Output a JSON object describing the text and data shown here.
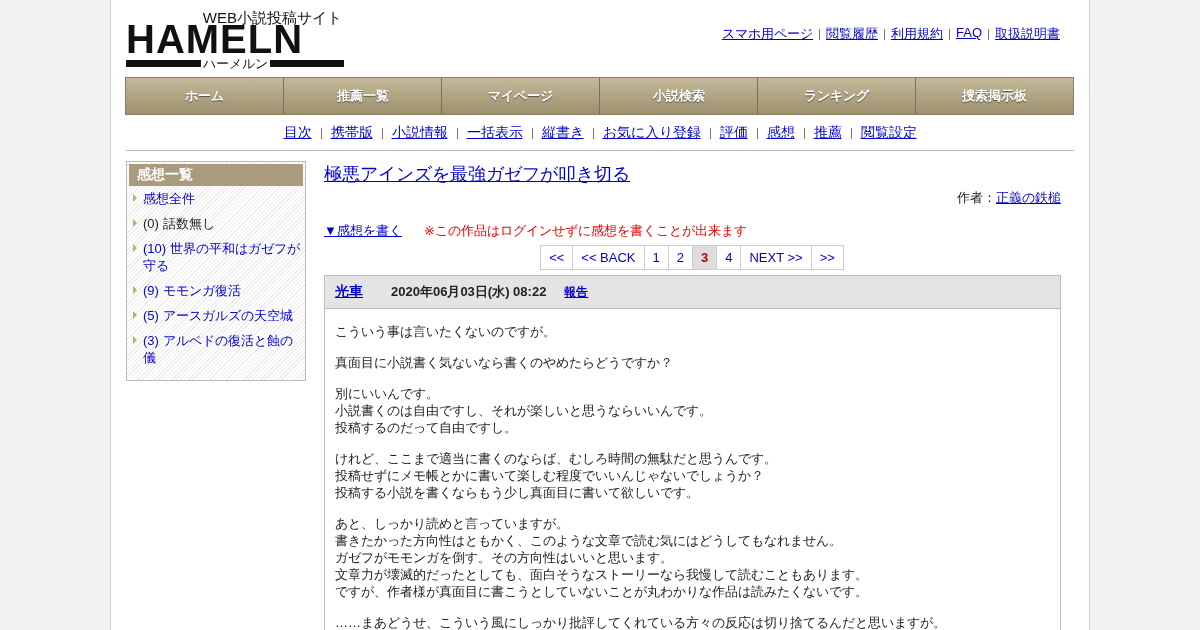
{
  "logo": {
    "tagline": "WEB小説投稿サイト",
    "wordmark": "HAMELN",
    "reading": "ハーメルン"
  },
  "top_links": [
    "スマホ用ページ",
    "閲覧履歴",
    "利用規約",
    "FAQ",
    "取扱説明書"
  ],
  "nav": [
    "ホーム",
    "推薦一覧",
    "マイページ",
    "小説検索",
    "ランキング",
    "捜索掲示板"
  ],
  "sub_nav": [
    "目次",
    "携帯版",
    "小説情報",
    "一括表示",
    "縦書き",
    "お気に入り登録",
    "評価",
    "感想",
    "推薦",
    "閲覧設定"
  ],
  "sidebar": {
    "title": "感想一覧",
    "items": [
      {
        "label": "感想全件",
        "kind": "link"
      },
      {
        "label": "(0) 話数無し",
        "kind": "text"
      },
      {
        "label": "(10) 世界の平和はガゼフが守る",
        "kind": "link"
      },
      {
        "label": "(9) モモンガ復活",
        "kind": "link"
      },
      {
        "label": "(5) アースガルズの天空城",
        "kind": "link"
      },
      {
        "label": "(3) アルベドの復活と蝕の儀",
        "kind": "link"
      }
    ]
  },
  "novel": {
    "title": "極悪アインズを最強ガゼフが叩き切る",
    "author_label": "作者：",
    "author": "正義の鉄槌"
  },
  "write_link": "▼感想を書く",
  "notice": "※この作品はログインせずに感想を書くことが出来ます",
  "pagination": [
    {
      "label": "<<",
      "selected": false
    },
    {
      "label": "<< BACK",
      "selected": false
    },
    {
      "label": "1",
      "selected": false
    },
    {
      "label": "2",
      "selected": false
    },
    {
      "label": "3",
      "selected": true
    },
    {
      "label": "4",
      "selected": false
    },
    {
      "label": "NEXT >>",
      "selected": false
    },
    {
      "label": ">>",
      "selected": false
    }
  ],
  "comment": {
    "user": "光車",
    "date": "2020年06月03日(水) 08:22",
    "report": "報告",
    "paragraphs": [
      [
        "こういう事は言いたくないのですが。"
      ],
      [
        "真面目に小説書く気ないなら書くのやめたらどうですか？"
      ],
      [
        "別にいいんです。",
        "小説書くのは自由ですし、それが楽しいと思うならいいんです。",
        "投稿するのだって自由ですし。"
      ],
      [
        "けれど、ここまで適当に書くのならば、むしろ時間の無駄だと思うんです。",
        "投稿せずにメモ帳とかに書いて楽しむ程度でいいんじゃないでしょうか？",
        "投稿する小説を書くならもう少し真面目に書いて欲しいです。"
      ],
      [
        "あと、しっかり読めと言っていますが。",
        "書きたかった方向性はともかく、このような文章で読む気にはどうしてもなれません。",
        "ガゼフがモモンガを倒す。その方向性はいいと思います。",
        "文章力が壊滅的だったとしても、面白そうなストーリーなら我慢して読むこともあります。",
        "ですが、作者様が真面目に書こうとしていないことが丸わかりな作品は読みたくないです。"
      ],
      [
        "……まあどうせ、こういう風にしっかり批評してくれている方々の反応は切り捨てるんだと思いますが。"
      ]
    ]
  }
}
